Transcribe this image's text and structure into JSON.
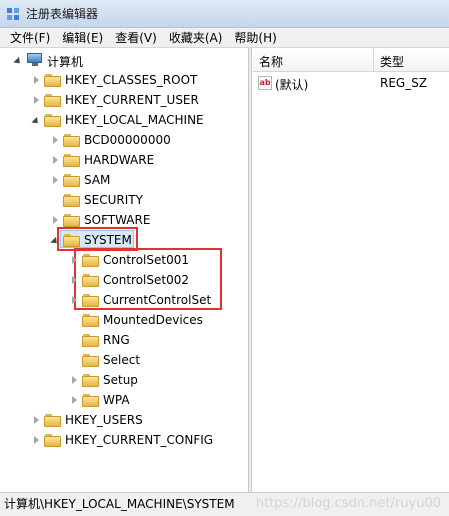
{
  "window": {
    "title": "注册表编辑器"
  },
  "menu": [
    "文件(F)",
    "编辑(E)",
    "查看(V)",
    "收藏夹(A)",
    "帮助(H)"
  ],
  "tree": {
    "root": "计算机",
    "hkcr": "HKEY_CLASSES_ROOT",
    "hkcu": "HKEY_CURRENT_USER",
    "hklm": "HKEY_LOCAL_MACHINE",
    "hklm_children": [
      "BCD00000000",
      "HARDWARE",
      "SAM",
      "SECURITY",
      "SOFTWARE"
    ],
    "system": "SYSTEM",
    "system_children": [
      "ControlSet001",
      "ControlSet002",
      "CurrentControlSet",
      "MountedDevices",
      "RNG",
      "Select",
      "Setup",
      "WPA"
    ],
    "hku": "HKEY_USERS",
    "hkcc": "HKEY_CURRENT_CONFIG"
  },
  "list": {
    "col_name": "名称",
    "col_type": "类型",
    "rows": [
      {
        "name": "(默认)",
        "type": "REG_SZ",
        "icon": "ab"
      }
    ]
  },
  "status": {
    "path": "计算机\\HKEY_LOCAL_MACHINE\\SYSTEM",
    "watermark": "https://blog.csdn.net/ruyu00"
  }
}
